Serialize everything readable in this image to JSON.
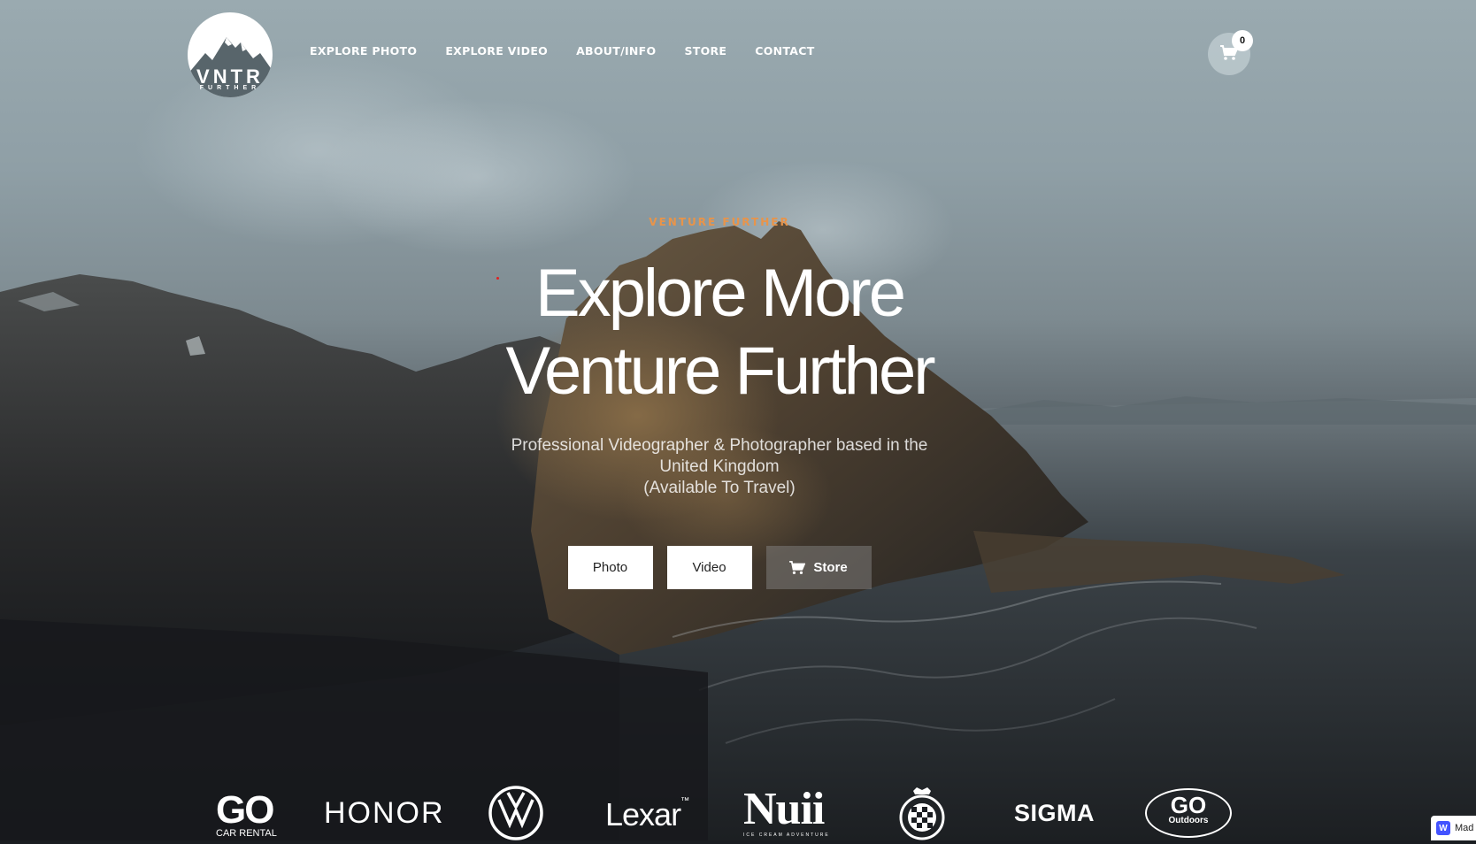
{
  "brand": {
    "name": "VNTR",
    "tagline": "FURTHER"
  },
  "nav": {
    "items": [
      {
        "label": "EXPLORE PHOTO"
      },
      {
        "label": "EXPLORE VIDEO"
      },
      {
        "label": "ABOUT/INFO"
      },
      {
        "label": "STORE"
      },
      {
        "label": "CONTACT"
      }
    ]
  },
  "cart": {
    "count": "0",
    "icon": "cart-icon"
  },
  "hero": {
    "eyebrow": "VENTURE FURTHER",
    "title_line1": "Explore More",
    "title_line2": "Venture Further",
    "subtitle_line1": "Professional Videographer & Photographer based in the",
    "subtitle_line2": "United Kingdom",
    "subtitle_line3": "(Available To Travel)",
    "eyebrow_color": "#e8944a"
  },
  "buttons": {
    "photo": "Photo",
    "video": "Video",
    "store": "Store"
  },
  "partners": {
    "go_car_rental_big": "GO",
    "go_car_rental_small": "CAR RENTAL",
    "honor": "HONOR",
    "volkswagen": "VW",
    "lexar": "Lexar",
    "lexar_tm": "™",
    "nuii": "Nuii",
    "nuii_tag": "ICE CREAM ADVENTURE",
    "goodwood": "GOODWOOD ROAD RACING CLUB",
    "sigma": "SIGMA",
    "go_outdoors_big": "GO",
    "go_outdoors_small": "Outdoors"
  },
  "widget": {
    "logo": "W",
    "text": "Mad"
  }
}
